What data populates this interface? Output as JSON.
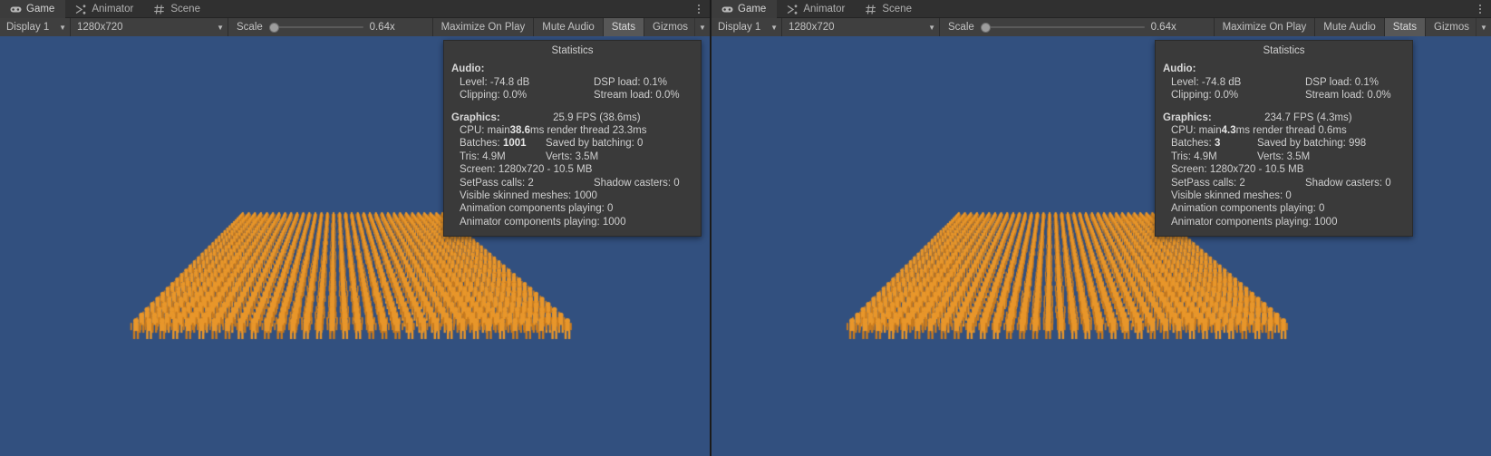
{
  "panels": [
    {
      "tabs": [
        {
          "label": "Game",
          "icon": "gamepad-icon",
          "active": true
        },
        {
          "label": "Animator",
          "icon": "animator-icon",
          "active": false
        },
        {
          "label": "Scene",
          "icon": "grid-icon",
          "active": false
        }
      ],
      "toolbar": {
        "display": "Display 1",
        "resolution": "1280x720",
        "scale_label": "Scale",
        "scale_value": "0.64x",
        "scale_position_pct": 0,
        "maximize_on_play": "Maximize On Play",
        "mute_audio": "Mute Audio",
        "stats": "Stats",
        "stats_active": true,
        "gizmos": "Gizmos"
      },
      "stats": {
        "title": "Statistics",
        "audio_header": "Audio:",
        "level": "Level: -74.8 dB",
        "clipping": "Clipping: 0.0%",
        "dsp_load": "DSP load: 0.1%",
        "stream_load": "Stream load: 0.0%",
        "graphics_header": "Graphics:",
        "fps": "25.9 FPS (38.6ms)",
        "cpu_prefix": "CPU: main ",
        "cpu_main": "38.6",
        "cpu_suffix": "ms  render thread 23.3ms",
        "batches_label": "Batches: ",
        "batches_value": "1001",
        "saved_by_batching": "Saved by batching: 0",
        "tris": "Tris: 4.9M",
        "verts": "Verts: 3.5M",
        "screen": "Screen: 1280x720 - 10.5 MB",
        "setpass": "SetPass calls: 2",
        "shadow_casters": "Shadow casters: 0",
        "visible_skinned": "Visible skinned meshes: 1000",
        "animation_components": "Animation components playing: 0",
        "animator_components": "Animator components playing: 1000"
      }
    },
    {
      "tabs": [
        {
          "label": "Game",
          "icon": "gamepad-icon",
          "active": true
        },
        {
          "label": "Animator",
          "icon": "animator-icon",
          "active": false
        },
        {
          "label": "Scene",
          "icon": "grid-icon",
          "active": false
        }
      ],
      "toolbar": {
        "display": "Display 1",
        "resolution": "1280x720",
        "scale_label": "Scale",
        "scale_value": "0.64x",
        "scale_position_pct": 0,
        "maximize_on_play": "Maximize On Play",
        "mute_audio": "Mute Audio",
        "stats": "Stats",
        "stats_active": true,
        "gizmos": "Gizmos"
      },
      "stats": {
        "title": "Statistics",
        "audio_header": "Audio:",
        "level": "Level: -74.8 dB",
        "clipping": "Clipping: 0.0%",
        "dsp_load": "DSP load: 0.1%",
        "stream_load": "Stream load: 0.0%",
        "graphics_header": "Graphics:",
        "fps": "234.7 FPS (4.3ms)",
        "cpu_prefix": "CPU: main ",
        "cpu_main": "4.3",
        "cpu_suffix": "ms  render thread 0.6ms",
        "batches_label": "Batches: ",
        "batches_value": "3",
        "saved_by_batching": "Saved by batching: 998",
        "tris": "Tris: 4.9M",
        "verts": "Verts: 3.5M",
        "screen": "Screen: 1280x720 - 10.5 MB",
        "setpass": "SetPass calls: 2",
        "shadow_casters": "Shadow casters: 0",
        "visible_skinned": "Visible skinned meshes: 0",
        "animation_components": "Animation components playing: 0",
        "animator_components": "Animator components playing: 1000"
      }
    }
  ],
  "scene": {
    "background_color": "#32507f",
    "character_color": "#e8962a",
    "character_shadow_color": "#c97b1e",
    "description": "Grid crowd of 1000 animated humanoid characters"
  }
}
